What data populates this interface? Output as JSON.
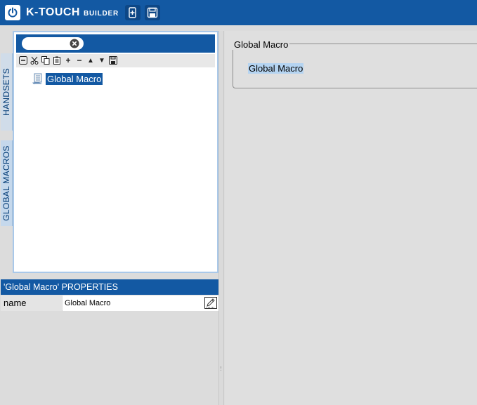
{
  "app": {
    "brand": "K-TOUCH",
    "brand_sub": "BUILDER"
  },
  "toolbar": {
    "buttons": [
      {
        "icon": "new-device-icon"
      },
      {
        "icon": "save-icon"
      }
    ]
  },
  "sidebar": {
    "tabs": [
      {
        "label": "HANDSETS",
        "active": false
      },
      {
        "label": "GLOBAL MACROS",
        "active": true
      }
    ]
  },
  "tree": {
    "search": {
      "value": "",
      "placeholder": ""
    },
    "tools": [
      "collapse-all",
      "cut",
      "copy",
      "paste",
      "add",
      "remove",
      "move-up",
      "move-down",
      "save"
    ],
    "tool_glyphs": {
      "add": "+",
      "remove": "−",
      "move-up": "▲",
      "move-down": "▼"
    },
    "nodes": [
      {
        "label": "Global Macro",
        "selected": true
      }
    ]
  },
  "properties": {
    "header": "'Global Macro' PROPERTIES",
    "rows": [
      {
        "key": "name",
        "value": "Global Macro"
      }
    ]
  },
  "detail": {
    "legend": "Global Macro",
    "selected_text": "Global Macro"
  },
  "colors": {
    "brand_blue": "#1359a3",
    "tab_bg": "#c5d8ec",
    "selection": "#b5d4f1"
  }
}
